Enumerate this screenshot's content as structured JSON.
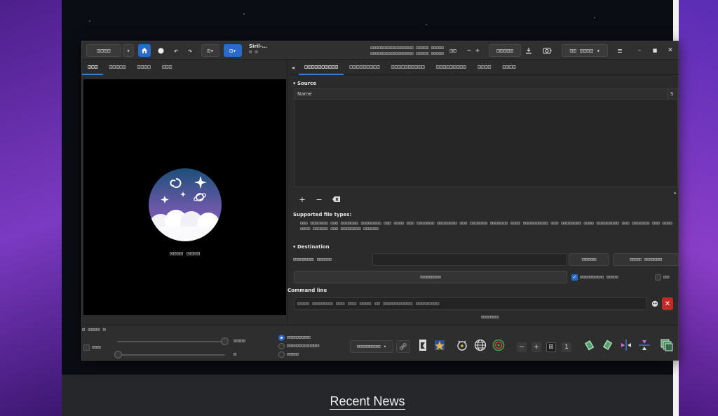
{
  "background": {
    "recent_news": "Recent News"
  },
  "headerbar": {
    "menu_label": "⊡⊡⊡⊡",
    "title_line1": "Siril-…",
    "title_line2": "⊡ ⊡",
    "cwd_line1": "⊡⊡⊡⊡⊡⊡⊡⊡⊡⊡⊡⊡⊡⊡⊡⊡⊡ ⊡⊡⊡⊡⊡ ⊡⊡⊡⊡⊡",
    "cwd_line2": "⊡⊡⊡⊡⊡⊡⊡⊡⊡⊡⊡⊡⊡⊡⊡⊡⊡ ⊡⊡⊡⊡⊡ ⊡⊡⊡⊡⊡",
    "zoom_label": "⊡⊡",
    "zoom_fit": "⊡⊡⊡⊡⊡",
    "display_mode": "⊡⊡ ⊡⊡⊡⊡"
  },
  "left_tabs": [
    "⊡⊡⊡",
    "⊡⊡⊡⊡⊡",
    "⊡⊡⊡⊡",
    "⊡⊡⊡"
  ],
  "preview": {
    "no_image_text": "⊡⊡⊡⊡ ⊡⊡⊡⊡"
  },
  "right_tabs": [
    "⊡⊡⊡⊡⊡⊡⊡⊡⊡⊡",
    "⊡⊡⊡⊡⊡⊡⊡⊡⊡",
    "⊡⊡⊡⊡⊡⊡⊡⊡⊡⊡",
    "⊡⊡⊡⊡⊡⊡⊡⊡⊡",
    "⊡⊡⊡⊡",
    "⊡⊡⊡⊡"
  ],
  "source": {
    "title": "Source",
    "col_name": "Name",
    "col_size": "S",
    "supported_title": "Supported file types:",
    "supported_text": "⊡⊡⊡ ⊡⊡⊡⊡⊡⊡⊡ ⊡⊡⊡ ⊡⊡⊡⊡⊡⊡⊡ ⊡⊡⊡⊡⊡⊡⊡⊡ ⊡⊡⊡ ⊡⊡⊡⊡ ⊡⊡⊡ ⊡⊡⊡⊡⊡⊡⊡ ⊡⊡⊡⊡⊡⊡⊡⊡ ⊡⊡⊡ ⊡⊡⊡⊡⊡⊡⊡ ⊡⊡⊡⊡⊡⊡⊡ ⊡⊡⊡⊡ ⊡⊡⊡⊡⊡⊡⊡⊡⊡⊡ ⊡⊡⊡ ⊡⊡⊡⊡⊡⊡⊡⊡ ⊡⊡⊡⊡ ⊡⊡⊡⊡⊡⊡⊡⊡⊡ ⊡⊡⊡ ⊡⊡⊡⊡⊡⊡⊡ ⊡⊡⊡ ⊡⊡⊡⊡⊡⊡⊡⊡ ⊡⊡⊡⊡⊡⊡ ⊡⊡⊡ ⊡⊡⊡⊡⊡⊡⊡⊡ ⊡⊡⊡⊡⊡⊡"
  },
  "destination": {
    "title": "Destination",
    "name_label": "⊡⊡⊡⊡⊡⊡⊡ ⊡⊡⊡⊡⊡",
    "btn_a": "⊡⊡⊡⊡⊡",
    "btn_b": "⊡⊡⊡⊡ ⊡⊡⊡⊡⊡⊡",
    "btn_convert": "⊡⊡⊡⊡⊡⊡⊡",
    "check_a_label": "⊡⊡⊡⊡⊡⊡⊡⊡ ⊡⊡⊡⊡",
    "check_b_label": "⊡⊡"
  },
  "command": {
    "title": "Command line",
    "placeholder": "⊡⊡⊡⊡ ⊡⊡⊡⊡⊡⊡⊡ ⊡⊡⊡ ⊡⊡⊡ ⊡⊡⊡⊡ ⊡⊡ ⊡⊡⊡⊡⊡⊡⊡⊡⊡⊡ ⊡⊡⊡⊡⊡⊡⊡⊡",
    "bottom_text": "⊡⊡⊡⊡⊡⊡"
  },
  "bottom": {
    "group_label": "⊡ ⊡⊡⊡⊡ ⊡",
    "check_label": "⊡⊡⊡",
    "slider_value_hi": "⊡⊡⊡⊡",
    "slider_value_lo": "⊡",
    "radio_1": "⊡⊡⊡⊡⊡⊡⊡⊡",
    "radio_2": "⊡⊡⊡⊡⊡⊡⊡⊡⊡⊡⊡",
    "radio_3": "⊡⊡⊡⊡",
    "stretch_select": "⊡⊡⊡⊡⊡⊡⊡⊡"
  }
}
